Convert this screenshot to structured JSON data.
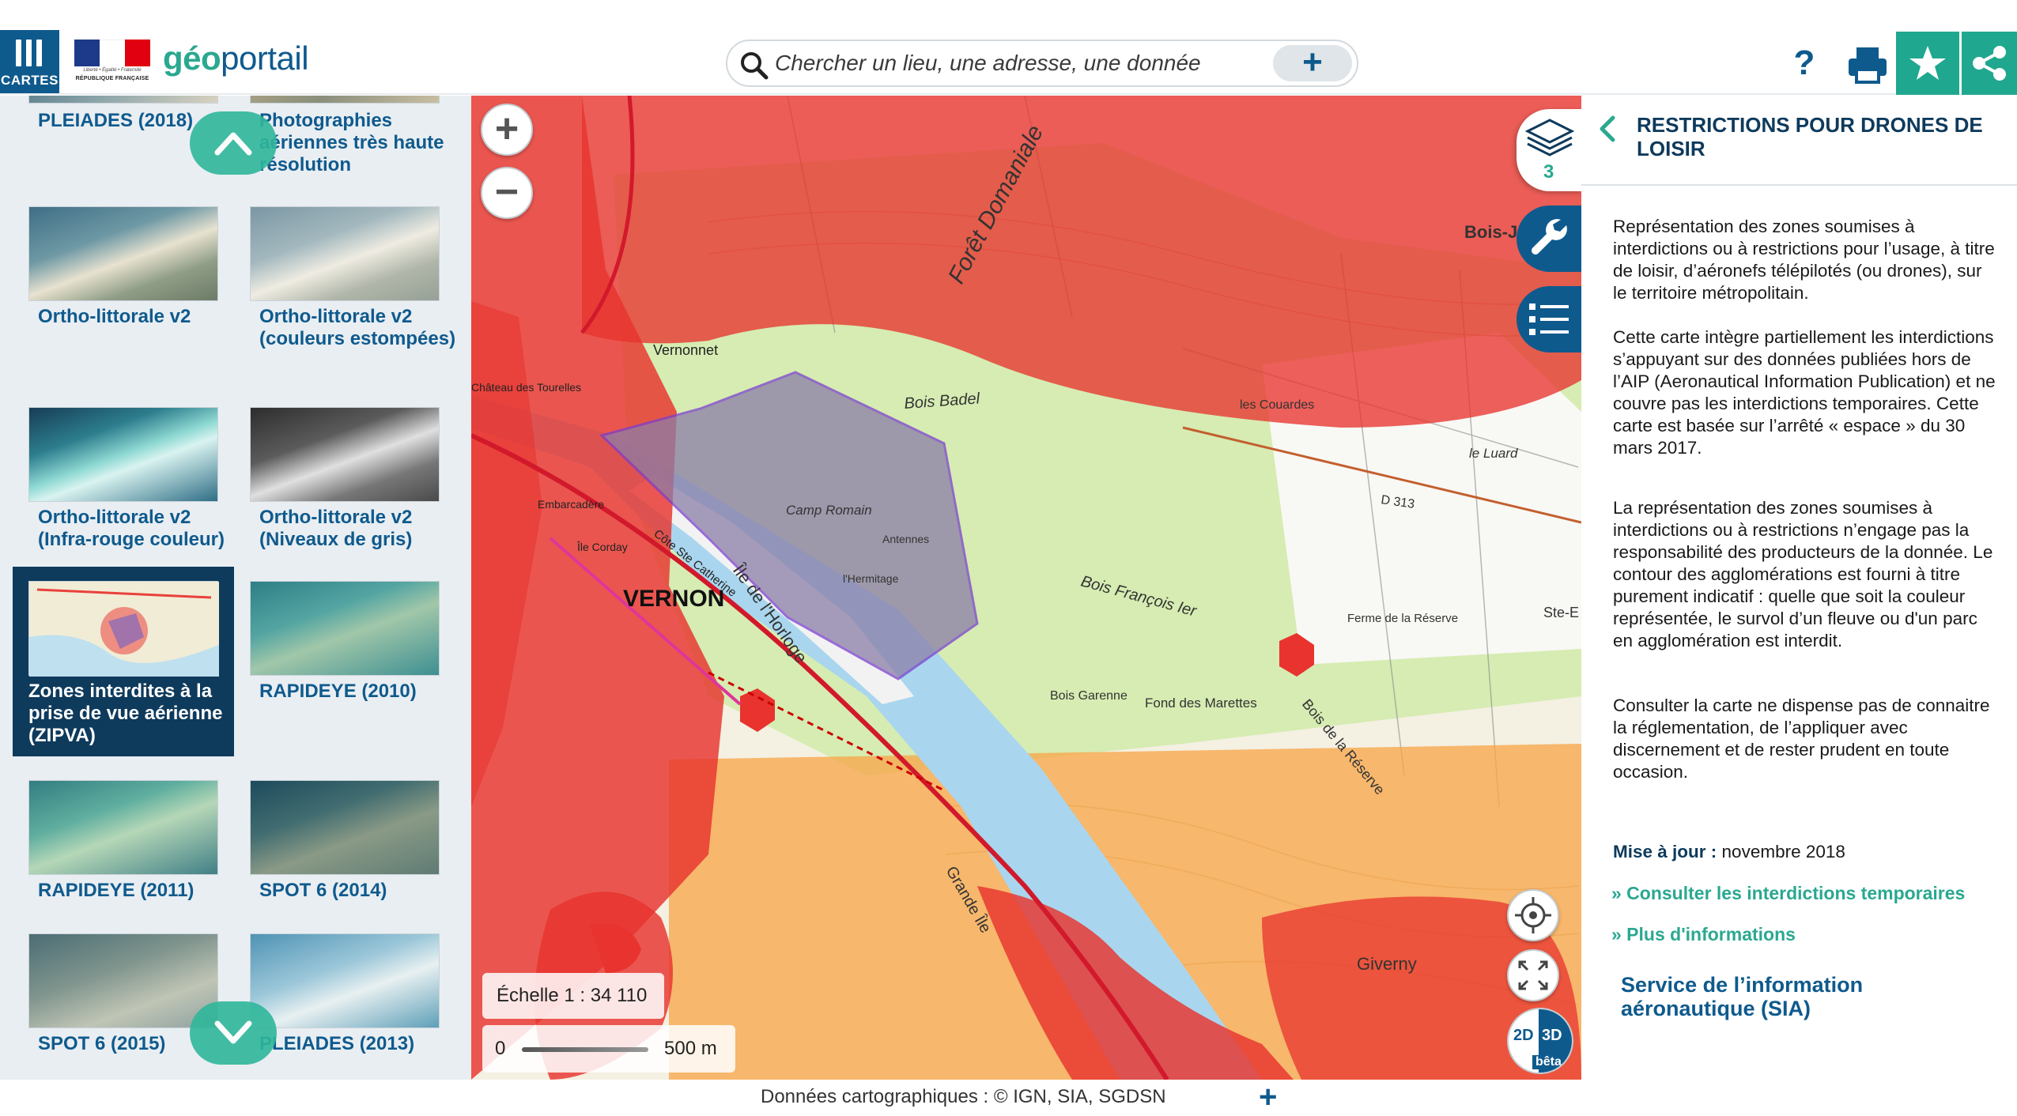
{
  "header": {
    "menu_label": "CARTES",
    "logo_motto": "Liberté • Égalité • Fraternité",
    "logo_country": "RÉPUBLIQUE FRANÇAISE",
    "brand_prefix": "géo",
    "brand_suffix": "portail",
    "search_placeholder": "Chercher un lieu, une adresse, une donnée",
    "search_add": "+",
    "help": "?",
    "icons": [
      "menu-bars-icon",
      "search-icon",
      "print-icon",
      "star-icon",
      "share-icon"
    ]
  },
  "catalog": {
    "tiles": [
      {
        "label": "PLEIADES (2018)",
        "selected": false
      },
      {
        "label": "Photographies aériennes très haute résolution",
        "selected": false
      },
      {
        "label": "Ortho-littorale v2",
        "selected": false
      },
      {
        "label": "Ortho-littorale v2 (couleurs estompées)",
        "selected": false
      },
      {
        "label": "Ortho-littorale v2 (Infra-rouge couleur)",
        "selected": false
      },
      {
        "label": "Ortho-littorale v2 (Niveaux de gris)",
        "selected": false
      },
      {
        "label": "Zones interdites à la prise de vue aérienne (ZIPVA)",
        "selected": true
      },
      {
        "label": "RAPIDEYE (2010)",
        "selected": false
      },
      {
        "label": "RAPIDEYE (2011)",
        "selected": false
      },
      {
        "label": "SPOT 6 (2014)",
        "selected": false
      },
      {
        "label": "SPOT 6 (2015)",
        "selected": false
      },
      {
        "label": "PLEIADES (2013)",
        "selected": false
      }
    ]
  },
  "map": {
    "zoom_in": "+",
    "zoom_out": "−",
    "scale_text": "Échelle 1 : 34 110",
    "scalebar_zero": "0",
    "scalebar_length": "500 m",
    "dim_2d": "2D",
    "dim_3d": "3D",
    "dim_beta": "bêta",
    "labels": {
      "vernon": "VERNON",
      "vernonnet": "Vernonnet",
      "camp_romain": "Camp Romain",
      "bois_badel": "Bois Badel",
      "le_luard": "le Luard",
      "ferme": "Ferme de la Réserve",
      "fond_marettes": "Fond des Marettes",
      "bois_garenne": "Bois Garenne",
      "giverny": "Giverny",
      "grande_ile": "Grande Île",
      "ile_horloge": "Île de l'Horloge",
      "foret": "Forêt Domaniale",
      "d313": "D 313",
      "les_couardes": "les Couardes",
      "chateau": "Château des Tourelles",
      "embarcadere": "Embarcadère",
      "cote_ste_catherine": "Côte Ste Catherine",
      "bois_francois": "Bois François Ier",
      "ile_corday": "Île Corday",
      "bois_reserve": "Bois de la Réserve",
      "bois_stc": "Bois-J St-C",
      "ste_e": "Ste-E",
      "antennes": "Antennes",
      "hermitage": "l'Hermitage"
    },
    "zone_colors": {
      "forbidden": "#e8332e",
      "restricted": "#f7a64a",
      "military": "#8b7ea8",
      "water": "#a9d6ee",
      "forest": "#cfe9a8"
    }
  },
  "tools": {
    "layers_count": "3",
    "icons": [
      "layers-icon",
      "wrench-icon",
      "legend-list-icon"
    ]
  },
  "panel": {
    "title": "RESTRICTIONS POUR DRONES DE LOISIR",
    "para1": "Représentation des zones soumises à interdictions ou à restrictions pour l’usage, à titre de loisir, d’aéronefs télépilotés (ou drones), sur le territoire métropolitain.",
    "para2": "Cette carte intègre partiellement les interdictions s’appuyant sur des données publiées hors de l’AIP (Aeronautical Information Publication) et ne couvre pas les interdictions temporaires. Cette carte est basée sur l’arrêté « espace » du 30 mars 2017.",
    "para3": "La représentation des zones soumises à interdictions ou à restrictions n’engage pas la responsabilité des producteurs de la donnée. Le contour des agglomérations est fourni à titre purement indicatif : quelle que soit la couleur représentée, le survol d’un fleuve ou d'un parc en agglomération est interdit.",
    "para4": "Consulter la carte ne dispense pas de connaitre la réglementation, de l’appliquer avec discernement et de rester prudent en toute occasion.",
    "update_label": "Mise à jour :",
    "update_value": "novembre 2018",
    "link1": "» Consulter les interdictions temporaires",
    "link2": "» Plus d'informations",
    "sia": "Service de l’information aéronautique (SIA)"
  },
  "footer": {
    "credits": "Données cartographiques : ©  IGN,  SIA,  SGDSN",
    "plus": "+"
  }
}
